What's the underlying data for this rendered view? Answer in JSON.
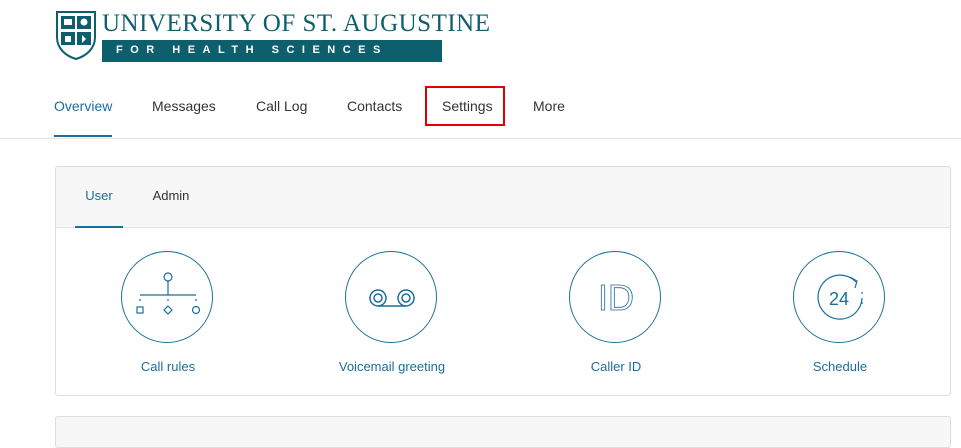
{
  "logo": {
    "name": "UNIVERSITY OF ST. AUGUSTINE",
    "tagline": "FOR HEALTH SCIENCES"
  },
  "nav": {
    "items": [
      {
        "label": "Overview",
        "active": true
      },
      {
        "label": "Messages",
        "active": false
      },
      {
        "label": "Call Log",
        "active": false
      },
      {
        "label": "Contacts",
        "active": false
      },
      {
        "label": "Settings",
        "active": false
      },
      {
        "label": "More",
        "active": false
      }
    ],
    "highlighted": "Settings"
  },
  "settings": {
    "tabs": [
      {
        "label": "User",
        "active": true
      },
      {
        "label": "Admin",
        "active": false
      }
    ],
    "tiles": [
      {
        "label": "Call rules",
        "icon": "call-rules-icon"
      },
      {
        "label": "Voicemail greeting",
        "icon": "voicemail-icon"
      },
      {
        "label": "Caller ID",
        "icon": "caller-id-icon",
        "icon_text": "ID"
      },
      {
        "label": "Schedule",
        "icon": "schedule-24-icon",
        "icon_text": "24"
      }
    ]
  },
  "colors": {
    "brand": "#0e5f6e",
    "accent": "#1a6e9a",
    "highlight": "#e00000"
  }
}
